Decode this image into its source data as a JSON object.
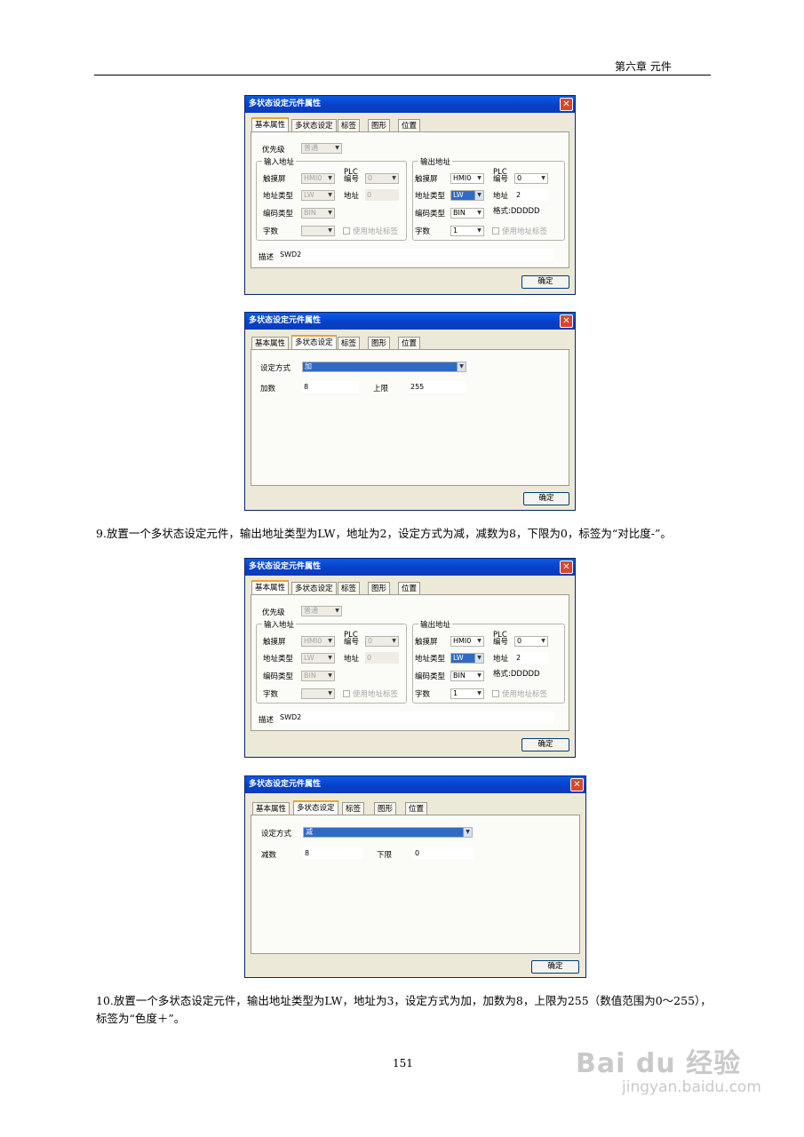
{
  "header": {
    "title": "第六章 元件"
  },
  "paragraphs": {
    "p9": "9.放置一个多状态设定元件，输出地址类型为LW，地址为2，设定方式为减，减数为8，下限为0，标签为“对比度-”。",
    "p10": "10.放置一个多状态设定元件，输出地址类型为LW，地址为3，设定方式为加，加数为8，上限为255（数值范围为0～255），标签为“色度＋”。"
  },
  "page_number": "151",
  "watermark": {
    "logo": "Bai du 经验",
    "url": "jingyan.baidu.com"
  },
  "dialog_common": {
    "title": "多状态设定元件属性",
    "close": "✕",
    "tabs": [
      "基本属性",
      "多状态设定",
      "标签",
      "图形",
      "位置"
    ],
    "ok": "确定"
  },
  "basic": {
    "priority_label": "优先级",
    "priority_value": "普通",
    "input_group": "输入地址",
    "output_group": "输出地址",
    "touch_label": "触摸屏",
    "plc_label": "PLC 编号",
    "addr_type_label": "地址类型",
    "addr_label": "地址",
    "code_type_label": "编码类型",
    "word_count_label": "字数",
    "use_tag_label": "使用地址标签",
    "format_label": "格式:DDDDD",
    "desc_label": "描述",
    "input": {
      "touch": "HMI0",
      "plc": "0",
      "addr_type": "LW",
      "addr": "0",
      "code_type": "BIN",
      "word_count": ""
    },
    "output": {
      "touch": "HMI0",
      "plc": "0",
      "addr_type": "LW",
      "addr": "2",
      "code_type": "BIN",
      "word_count": "1"
    },
    "description": "SWD2"
  },
  "multistate_add": {
    "mode_label": "设定方式",
    "mode_value": "加",
    "value_label": "加数",
    "value": "8",
    "limit_label": "上限",
    "limit": "255"
  },
  "multistate_sub": {
    "mode_label": "设定方式",
    "mode_value": "减",
    "value_label": "减数",
    "value": "8",
    "limit_label": "下限",
    "limit": "0"
  }
}
